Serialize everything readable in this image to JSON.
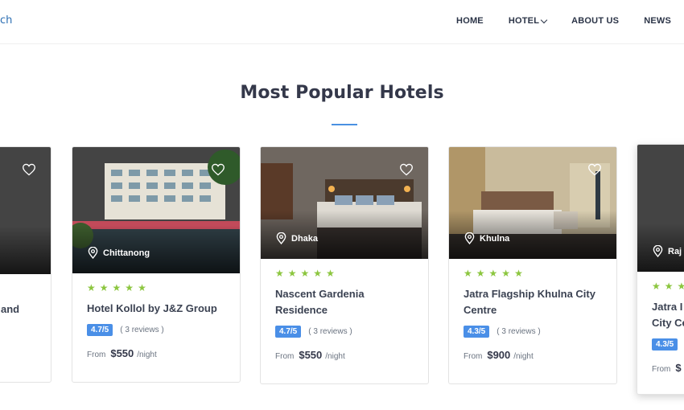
{
  "header": {
    "logo_text": "ch",
    "nav": [
      {
        "label": "HOME"
      },
      {
        "label": "HOTEL"
      },
      {
        "label": "ABOUT US"
      },
      {
        "label": "NEWS"
      }
    ]
  },
  "section": {
    "title": "Most Popular Hotels"
  },
  "cards": [
    {
      "name": "and",
      "location": "",
      "rating": "",
      "reviews": "",
      "from": "",
      "price": "",
      "per": ""
    },
    {
      "name": "Hotel Kollol by J&Z Group",
      "location": "Chittanong",
      "stars": 5,
      "rating": "4.7/5",
      "reviews": "( 3 reviews )",
      "from": "From",
      "price": "$550",
      "per": "/night"
    },
    {
      "name": "Nascent Gardenia Residence",
      "location": "Dhaka",
      "stars": 5,
      "rating": "4.7/5",
      "reviews": "( 3 reviews )",
      "from": "From",
      "price": "$550",
      "per": "/night"
    },
    {
      "name": "Jatra Flagship Khulna City Centre",
      "location": "Khulna",
      "stars": 5,
      "rating": "4.3/5",
      "reviews": "( 3 reviews )",
      "from": "From",
      "price": "$900",
      "per": "/night"
    },
    {
      "name": "Jatra I City Ce",
      "location": "Raj",
      "stars": 5,
      "rating": "4.3/5",
      "reviews": "",
      "from": "From",
      "price": "$",
      "per": ""
    }
  ],
  "icons": {
    "heart": "heart-icon",
    "location": "location-pin-icon",
    "star": "star-icon",
    "chevron": "chevron-down-icon"
  },
  "colors": {
    "accent": "#4a8fe7",
    "star": "#8cc63f",
    "title": "#34384a"
  }
}
